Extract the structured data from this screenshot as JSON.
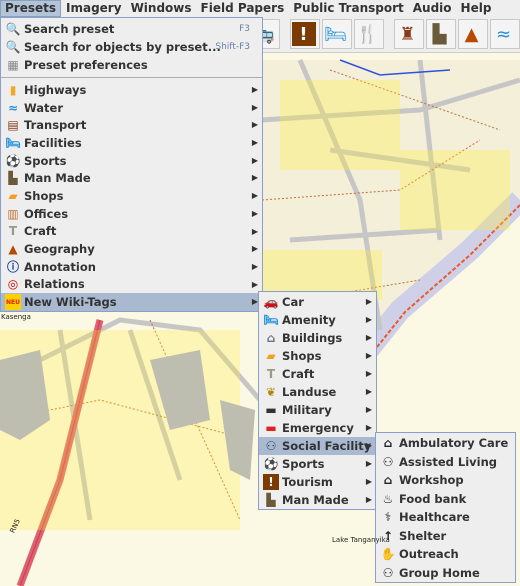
{
  "menubar": [
    "Presets",
    "Imagery",
    "Windows",
    "Field Papers",
    "Public Transport",
    "Audio",
    "Help"
  ],
  "toolbar": [
    {
      "icon": "bus-icon"
    },
    {
      "icon": "tourism-icon"
    },
    {
      "icon": "bed-icon"
    },
    {
      "icon": "restaurant-icon"
    },
    {
      "icon": "castle-icon"
    },
    {
      "icon": "factory-icon"
    },
    {
      "icon": "peak-icon"
    },
    {
      "icon": "water-icon"
    }
  ],
  "presets_menu": {
    "top_items": [
      {
        "label": "Search preset",
        "shortcut": "F3",
        "icon": "search-icon"
      },
      {
        "label": "Search for objects by preset...",
        "shortcut": "Shift-F3",
        "icon": "search-icon"
      },
      {
        "label": "Preset preferences",
        "icon": "preferences-icon"
      }
    ],
    "items": [
      {
        "label": "Highways",
        "icon": "highway-icon"
      },
      {
        "label": "Water",
        "icon": "water-icon"
      },
      {
        "label": "Transport",
        "icon": "railway-icon"
      },
      {
        "label": "Facilities",
        "icon": "bed-icon"
      },
      {
        "label": "Sports",
        "icon": "soccer-ball-icon"
      },
      {
        "label": "Man Made",
        "icon": "factory-icon"
      },
      {
        "label": "Shops",
        "icon": "shopping-bag-icon"
      },
      {
        "label": "Offices",
        "icon": "office-icon"
      },
      {
        "label": "Craft",
        "icon": "craft-icon"
      },
      {
        "label": "Geography",
        "icon": "peak-icon"
      },
      {
        "label": "Annotation",
        "icon": "info-icon"
      },
      {
        "label": "Relations",
        "icon": "relations-icon"
      },
      {
        "label": "New Wiki-Tags",
        "icon": "new-badge-icon",
        "selected": true
      }
    ]
  },
  "wiki_submenu": [
    {
      "label": "Car",
      "icon": "car-icon"
    },
    {
      "label": "Amenity",
      "icon": "bed-icon"
    },
    {
      "label": "Buildings",
      "icon": "building-icon"
    },
    {
      "label": "Shops",
      "icon": "shopping-bag-icon"
    },
    {
      "label": "Craft",
      "icon": "craft-icon"
    },
    {
      "label": "Landuse",
      "icon": "wheat-icon"
    },
    {
      "label": "Military",
      "icon": "tank-icon"
    },
    {
      "label": "Emergency",
      "icon": "fire-truck-icon"
    },
    {
      "label": "Social Facility",
      "icon": "social-facility-icon",
      "selected": true
    },
    {
      "label": "Sports",
      "icon": "soccer-ball-icon"
    },
    {
      "label": "Tourism",
      "icon": "tourism-icon"
    },
    {
      "label": "Man Made",
      "icon": "factory-icon"
    }
  ],
  "social_submenu": [
    {
      "label": "Ambulatory Care",
      "icon": "ambulatory-care-icon"
    },
    {
      "label": "Assisted Living",
      "icon": "assisted-living-icon"
    },
    {
      "label": "Workshop",
      "icon": "workshop-icon"
    },
    {
      "label": "Food bank",
      "icon": "food-bank-icon"
    },
    {
      "label": "Healthcare",
      "icon": "healthcare-icon"
    },
    {
      "label": "Shelter",
      "icon": "shelter-icon"
    },
    {
      "label": "Outreach",
      "icon": "outreach-icon"
    },
    {
      "label": "Group Home",
      "icon": "group-home-icon"
    }
  ],
  "map_labels": {
    "place": "Kasenga",
    "road": "RN5",
    "lake": "Lake Tanganyika"
  }
}
